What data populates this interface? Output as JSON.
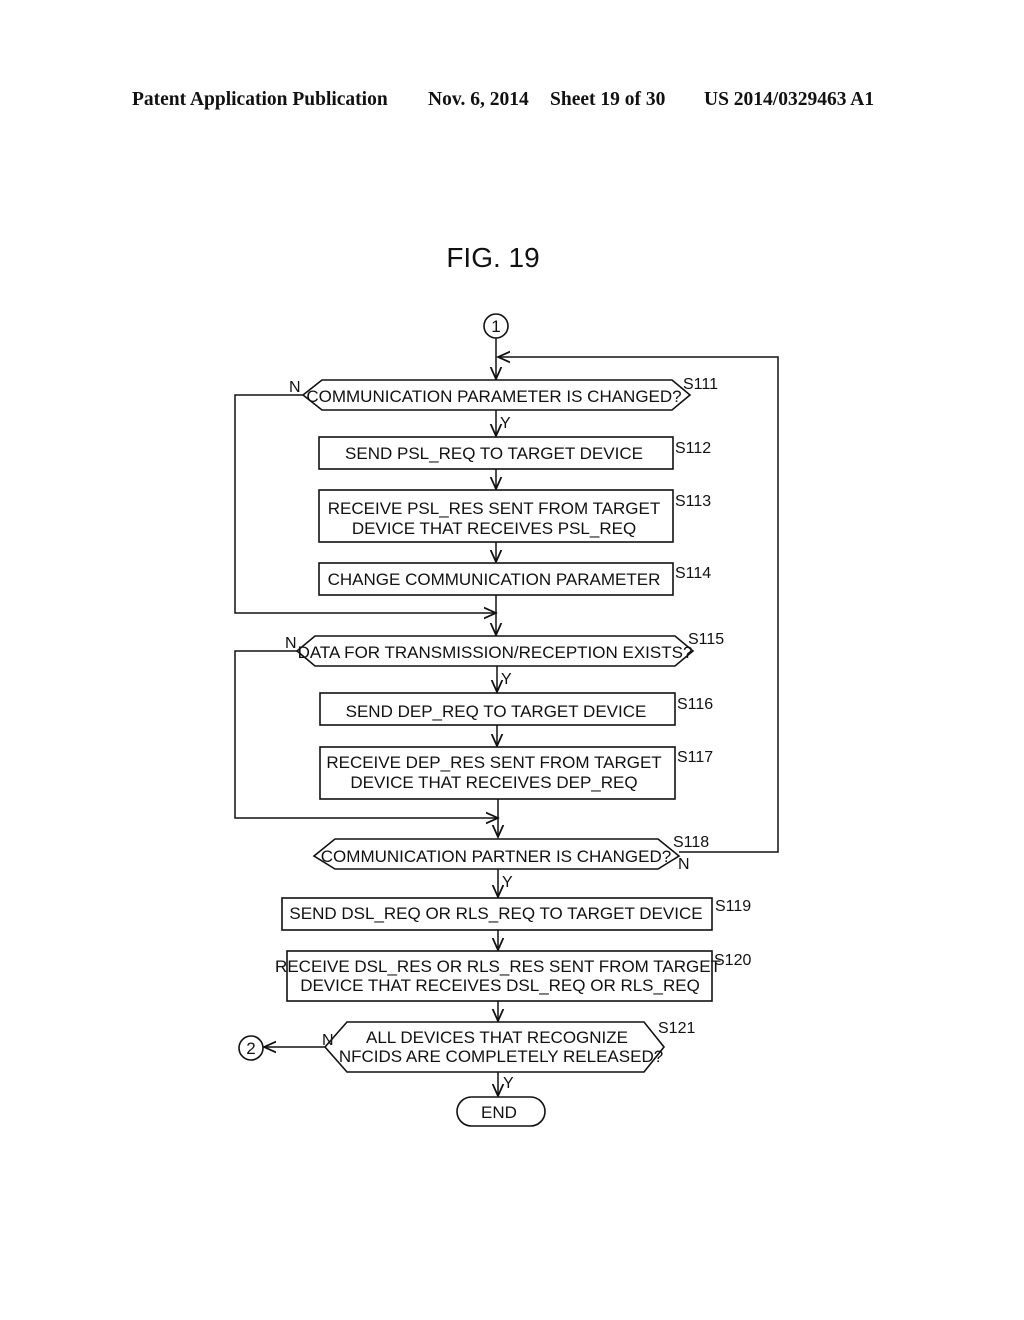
{
  "header": {
    "publication": "Patent Application Publication",
    "date": "Nov. 6, 2014",
    "sheet": "Sheet 19 of 30",
    "number": "US 2014/0329463 A1"
  },
  "figure": {
    "title": "FIG. 19",
    "connector_start": "1",
    "connector_exit": "2",
    "end_label": "END",
    "yes_label": "Y",
    "no_label": "N",
    "steps": {
      "s111": {
        "id": "S111",
        "type": "decision",
        "lines": [
          "COMMUNICATION PARAMETER IS CHANGED?"
        ]
      },
      "s112": {
        "id": "S112",
        "type": "process",
        "lines": [
          "SEND PSL_REQ TO TARGET DEVICE"
        ]
      },
      "s113": {
        "id": "S113",
        "type": "process",
        "lines": [
          "RECEIVE PSL_RES SENT FROM TARGET",
          "DEVICE THAT RECEIVES PSL_REQ"
        ]
      },
      "s114": {
        "id": "S114",
        "type": "process",
        "lines": [
          "CHANGE COMMUNICATION PARAMETER"
        ]
      },
      "s115": {
        "id": "S115",
        "type": "decision",
        "lines": [
          "DATA FOR TRANSMISSION/RECEPTION EXISTS?"
        ]
      },
      "s116": {
        "id": "S116",
        "type": "process",
        "lines": [
          "SEND DEP_REQ TO TARGET DEVICE"
        ]
      },
      "s117": {
        "id": "S117",
        "type": "process",
        "lines": [
          "RECEIVE DEP_RES SENT FROM TARGET",
          "DEVICE THAT RECEIVES DEP_REQ"
        ]
      },
      "s118": {
        "id": "S118",
        "type": "decision",
        "lines": [
          "COMMUNICATION PARTNER IS CHANGED?"
        ]
      },
      "s119": {
        "id": "S119",
        "type": "process",
        "lines": [
          "SEND DSL_REQ OR RLS_REQ TO TARGET DEVICE"
        ]
      },
      "s120": {
        "id": "S120",
        "type": "process",
        "lines": [
          "RECEIVE DSL_RES OR RLS_RES SENT FROM TARGET",
          "DEVICE THAT RECEIVES DSL_REQ OR RLS_REQ"
        ]
      },
      "s121": {
        "id": "S121",
        "type": "decision",
        "lines": [
          "ALL DEVICES THAT RECOGNIZE",
          "NFCIDS ARE COMPLETELY RELEASED?"
        ]
      }
    }
  }
}
